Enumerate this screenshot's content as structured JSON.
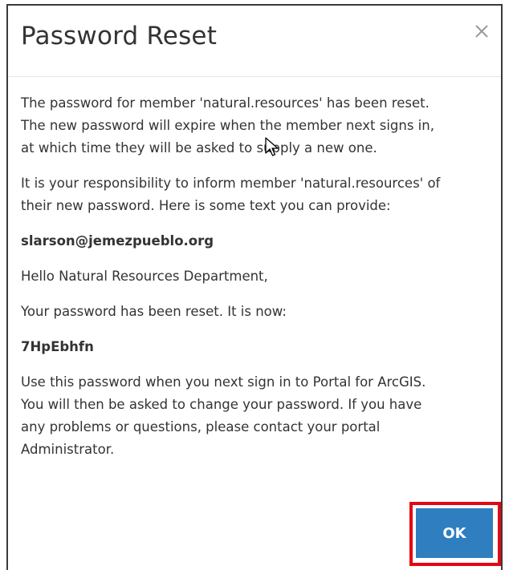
{
  "dialog": {
    "title": "Password Reset",
    "close_icon": "close-icon",
    "paragraphs": {
      "p1": "The password for member 'natural.resources' has been reset.\nThe new password will expire when the member next signs in,\nat which time they will be asked to supply a new one.",
      "p2": "It is your responsibility to inform member 'natural.resources' of\ntheir new password. Here is some text you can provide:",
      "email": "slarson@jemezpueblo.org",
      "greeting": "Hello Natural Resources Department,",
      "reset_notice": "Your password has been reset. It is now:",
      "new_password": "7HpEbhfn",
      "instructions": "Use this password when you next sign in to Portal for ArcGIS.\nYou will then be asked to change your password. If you have\nany problems or questions, please contact your portal\nAdministrator."
    },
    "ok_label": "OK"
  },
  "colors": {
    "ok_button": "#2f7fc0",
    "highlight": "#e30613",
    "text": "#333333"
  }
}
